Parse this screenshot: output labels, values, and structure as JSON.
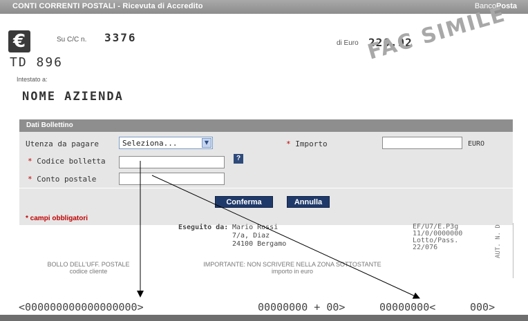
{
  "window": {
    "title": "CONTI CORRENTI POSTALI - Ricevuta di Accredito",
    "brand_light": "Banco",
    "brand_bold": "Posta"
  },
  "receipt": {
    "currency_symbol": "€",
    "account_label": "Su C/C n.",
    "account_number": "3376",
    "amount_label": "di Euro",
    "amount": "226,92",
    "td_code": "TD 896",
    "intestato_label": "Intestato a:",
    "company_name": "NOME AZIENDA",
    "watermark": "FAC SIMILE"
  },
  "form": {
    "section_title": "Dati Bollettino",
    "utenza_label": "Utenza da pagare",
    "utenza_selected": "Seleziona...",
    "importo_label": "Importo",
    "importo_unit": "EURO",
    "codice_label": "Codice bolletta",
    "conto_label": "Conto postale",
    "required_mark": "*",
    "help_label": "?",
    "confirm_button": "Conferma",
    "cancel_button": "Annulla",
    "required_note": "* campi obbligatori",
    "importo_value": "",
    "codice_value": "",
    "conto_value": ""
  },
  "slip": {
    "eseguito_label": "Eseguito da:",
    "payer_line1": "Mario Rossi",
    "payer_line2": "7/a, Diaz",
    "payer_line3": "24100 Bergamo",
    "ref_line1": "EF/U7/E.P3g",
    "ref_line2": "11/0/0000000",
    "ref_line3": "Lotto/Pass.",
    "ref_line4": "22/076",
    "vertical_text": "AUT. N. D",
    "bollo_line1": "BOLLO DELL'UFF. POSTALE",
    "bollo_line2": "codice cliente",
    "important_line1": "IMPORTANTE: NON SCRIVERE NELLA ZONA SOTTOSTANTE",
    "important_line2": "importo in euro",
    "ocr_code": "<000000000000000000>",
    "ocr_amount": "00000000 + 00>",
    "ocr_account": "00000000<",
    "ocr_type": "000>"
  },
  "colors": {
    "title_bar": "#9a9a9a",
    "panel_bg": "#e6e6e6",
    "panel_header": "#8e8e8e",
    "button_bg": "#1f3a6a",
    "required": "#c00000"
  }
}
